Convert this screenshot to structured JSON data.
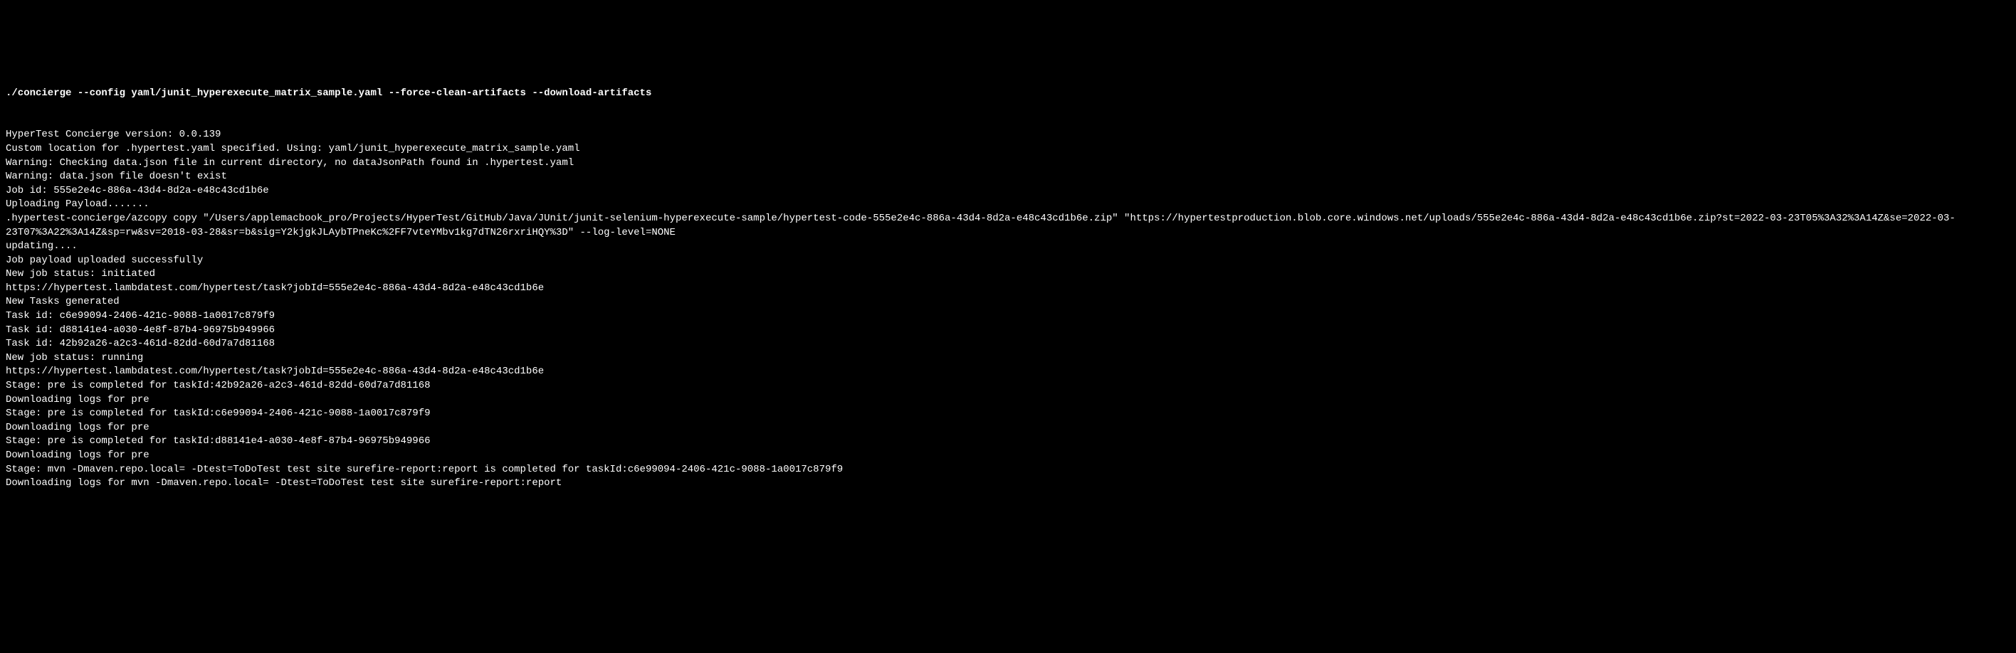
{
  "terminal": {
    "command": "./concierge --config yaml/junit_hyperexecute_matrix_sample.yaml --force-clean-artifacts --download-artifacts",
    "lines": [
      "",
      "HyperTest Concierge version: 0.0.139",
      "Custom location for .hypertest.yaml specified. Using: yaml/junit_hyperexecute_matrix_sample.yaml",
      "Warning: Checking data.json file in current directory, no dataJsonPath found in .hypertest.yaml",
      "Warning: data.json file doesn't exist",
      "Job id: 555e2e4c-886a-43d4-8d2a-e48c43cd1b6e",
      "Uploading Payload.......",
      ".hypertest-concierge/azcopy copy \"/Users/applemacbook_pro/Projects/HyperTest/GitHub/Java/JUnit/junit-selenium-hyperexecute-sample/hypertest-code-555e2e4c-886a-43d4-8d2a-e48c43cd1b6e.zip\" \"https://hypertestproduction.blob.core.windows.net/uploads/555e2e4c-886a-43d4-8d2a-e48c43cd1b6e.zip?st=2022-03-23T05%3A32%3A14Z&se=2022-03-23T07%3A22%3A14Z&sp=rw&sv=2018-03-28&sr=b&sig=Y2kjgkJLAybTPneKc%2FF7vteYMbv1kg7dTN26rxriHQY%3D\" --log-level=NONE",
      "updating....",
      "Job payload uploaded successfully",
      "New job status: initiated",
      "https://hypertest.lambdatest.com/hypertest/task?jobId=555e2e4c-886a-43d4-8d2a-e48c43cd1b6e",
      "New Tasks generated",
      "Task id: c6e99094-2406-421c-9088-1a0017c879f9",
      "Task id: d88141e4-a030-4e8f-87b4-96975b949966",
      "Task id: 42b92a26-a2c3-461d-82dd-60d7a7d81168",
      "New job status: running",
      "https://hypertest.lambdatest.com/hypertest/task?jobId=555e2e4c-886a-43d4-8d2a-e48c43cd1b6e",
      "Stage: pre is completed for taskId:42b92a26-a2c3-461d-82dd-60d7a7d81168",
      "Downloading logs for pre",
      "Stage: pre is completed for taskId:c6e99094-2406-421c-9088-1a0017c879f9",
      "Downloading logs for pre",
      "Stage: pre is completed for taskId:d88141e4-a030-4e8f-87b4-96975b949966",
      "Downloading logs for pre",
      "Stage: mvn -Dmaven.repo.local= -Dtest=ToDoTest test site surefire-report:report is completed for taskId:c6e99094-2406-421c-9088-1a0017c879f9",
      "Downloading logs for mvn -Dmaven.repo.local= -Dtest=ToDoTest test site surefire-report:report"
    ]
  }
}
